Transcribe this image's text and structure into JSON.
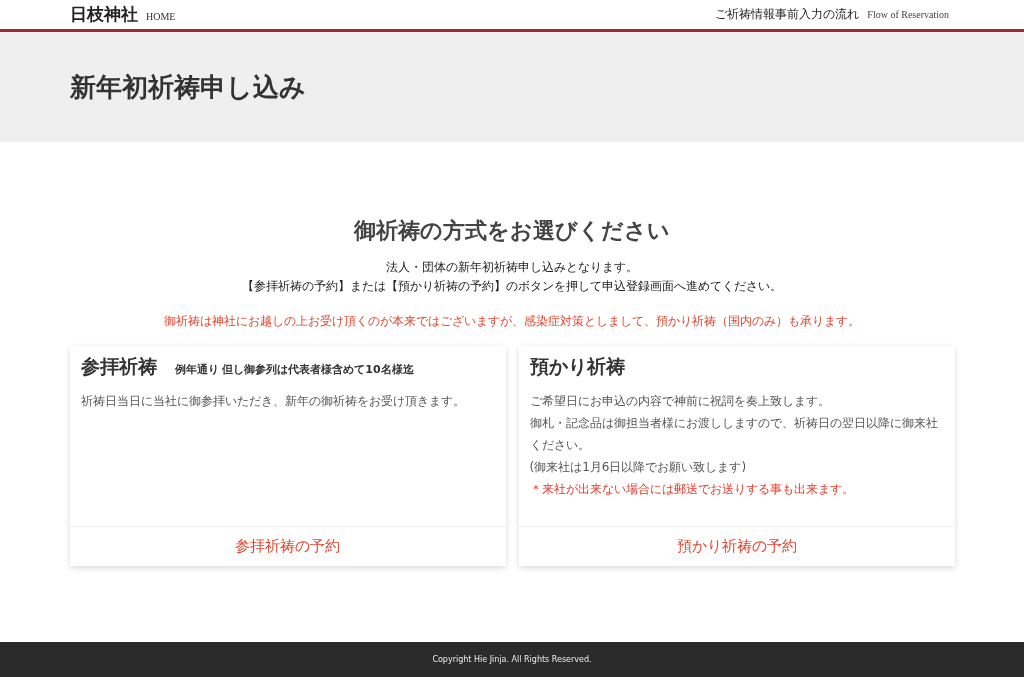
{
  "header": {
    "site_title": "日枝神社",
    "home_link": "HOME",
    "nav_link": "ご祈祷情報事前入力の流れ",
    "nav_link_sub": "Flow of Reservation"
  },
  "page_title": "新年初祈祷申し込み",
  "section": {
    "heading": "御祈祷の方式をお選びください",
    "intro": [
      "法人・団体の新年初祈祷申し込みとなります。",
      "【参拝祈祷の予約】または【預かり祈祷の予約】のボタンを押して申込登録画面へ進めてください。"
    ],
    "notice": "御祈祷は神社にお越しの上お受け頂くのが本来ではございますが、感染症対策としまして、預かり祈祷（国内のみ）も承ります。"
  },
  "cards": [
    {
      "title": "参拝祈祷",
      "subtitle": "例年通り 但し御参列は代表者様含めて10名様迄",
      "lines": [
        {
          "kind": "normal",
          "text": "祈祷日当日に当社に御参拝いただき、新年の御祈祷をお受け頂きます。"
        }
      ],
      "button": "参拝祈祷の予約"
    },
    {
      "title": "預かり祈祷",
      "lines": [
        {
          "kind": "normal",
          "text": "ご希望日にお申込の内容で神前に祝詞を奏上致します。"
        },
        {
          "kind": "normal",
          "text": "御札・記念品は御担当者様にお渡ししますので、祈祷日の翌日以降に御来社ください。"
        },
        {
          "kind": "normal",
          "text": "(御来社は1月6日以降でお願い致します)"
        },
        {
          "kind": "warning",
          "text": "＊来社が出来ない場合には郵送でお送りする事も出来ます。"
        }
      ],
      "button": "預かり祈祷の予約"
    }
  ],
  "footer": "Copyright Hie Jinja. All Rights Reserved."
}
